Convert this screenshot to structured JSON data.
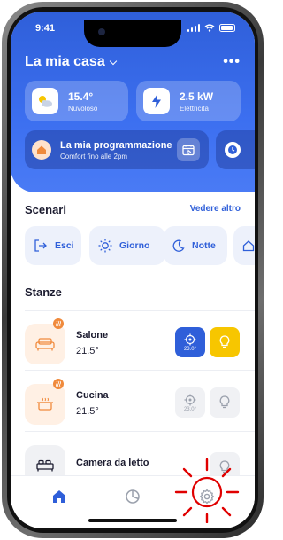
{
  "status_bar": {
    "time": "9:41"
  },
  "header": {
    "title": "La mia casa",
    "more_label": "•••"
  },
  "stats": {
    "weather": {
      "value": "15.4°",
      "label": "Nuvoloso",
      "icon": "cloud-sun-icon"
    },
    "energy": {
      "value": "2.5 kW",
      "label": "Elettricità",
      "icon": "lightning-icon"
    }
  },
  "schedule": {
    "title": "La mia programmazione",
    "subtitle": "Comfort fino alle 2pm"
  },
  "scenes": {
    "title": "Scenari",
    "see_more": "Vedere altro",
    "items": [
      {
        "label": "Esci",
        "icon": "exit-icon"
      },
      {
        "label": "Giorno",
        "icon": "sun-icon"
      },
      {
        "label": "Notte",
        "icon": "moon-icon"
      },
      {
        "label": "",
        "icon": "home-icon"
      }
    ]
  },
  "rooms": {
    "title": "Stanze",
    "items": [
      {
        "name": "Salone",
        "temp": "21.5°",
        "target": "23.0°",
        "active": true
      },
      {
        "name": "Cucina",
        "temp": "21.5°",
        "target": "23.0°",
        "active": false
      },
      {
        "name": "Camera da letto",
        "temp": "",
        "target": "",
        "active": false
      }
    ]
  },
  "colors": {
    "primary": "#2f5fd9",
    "light_active": "#f7c600",
    "accent_orange": "#f08a3c",
    "highlight_red": "#e00000"
  },
  "tabbar": {
    "items": [
      "home-icon",
      "pie-chart-icon",
      "settings-gear-icon"
    ],
    "active": "home-icon"
  }
}
